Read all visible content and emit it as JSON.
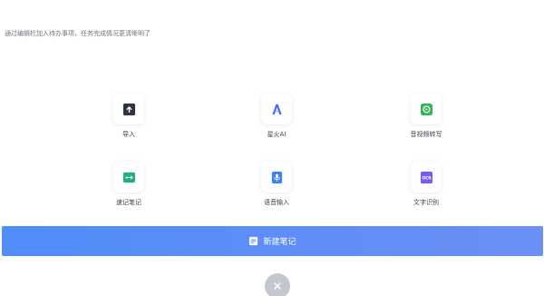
{
  "hint_text": "通过编辑栏加入待办事项，任务完成情况更清晰明了",
  "tiles": [
    {
      "label": "导入",
      "icon": "import-icon"
    },
    {
      "label": "星火AI",
      "icon": "spark-ai-icon"
    },
    {
      "label": "音视频转写",
      "icon": "audio-video-transcribe-icon"
    },
    {
      "label": "速记笔记",
      "icon": "shorthand-note-icon"
    },
    {
      "label": "语音输入",
      "icon": "voice-input-icon"
    },
    {
      "label": "文字识别",
      "icon": "ocr-icon"
    }
  ],
  "new_note_button": {
    "label": "新建笔记",
    "icon": "note-icon"
  },
  "close_button": {
    "icon": "close-icon"
  },
  "colors": {
    "primary": "#4f8df7",
    "import": "#2f3440",
    "spark_ai": "#3b6ff5",
    "transcribe": "#37b356",
    "shorthand": "#23b07d",
    "voice": "#3b82f6",
    "ocr": "#7b5cf0",
    "close_bg": "#c4c7cd"
  }
}
